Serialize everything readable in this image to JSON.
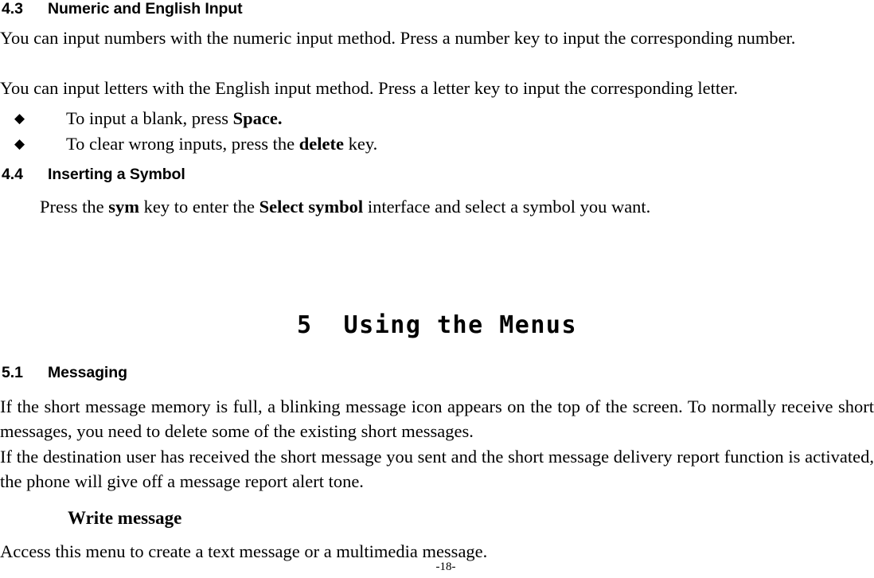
{
  "document": {
    "page_number": "-18-"
  },
  "sections": {
    "s43": {
      "number": "4.3",
      "title": "Numeric and English Input",
      "paragraph_1": "You can input numbers with the numeric input method. Press a number key to input the corresponding number.",
      "paragraph_2": "You can input letters with the English input method. Press a letter key to input the corresponding letter.",
      "bullets": [
        {
          "glyph": "diamond-bullet-icon",
          "symbol": "◆",
          "text_before": "To input a blank, press ",
          "text_bold": "Space.",
          "text_after": ""
        },
        {
          "glyph": "diamond-bullet-icon",
          "symbol": "◆",
          "text_before": "To clear wrong inputs, press the ",
          "text_bold": "delete",
          "text_after": " key."
        }
      ]
    },
    "s44": {
      "number": "4.4",
      "title": "Inserting a Symbol",
      "paragraph": {
        "part_1": "Press the ",
        "bold_1": "sym",
        "part_2": " key to enter the ",
        "bold_2": "Select symbol",
        "part_3": " interface and select a symbol you want."
      }
    },
    "chapter5": {
      "number": "5",
      "title": "Using the Menus",
      "full_text": "5  Using the Menus"
    },
    "s51": {
      "number": "5.1",
      "title": "Messaging",
      "paragraph_1": "If the short message memory is full, a blinking message icon appears on the top of the screen. To normally receive short messages, you need to delete some of the existing short messages.",
      "paragraph_2": "If the destination user has received the short message you sent and the short message delivery report function is activated, the phone will give off a message report alert tone.",
      "subheading": "Write message",
      "paragraph_3": "Access this menu to create a text message or a multimedia message."
    }
  }
}
